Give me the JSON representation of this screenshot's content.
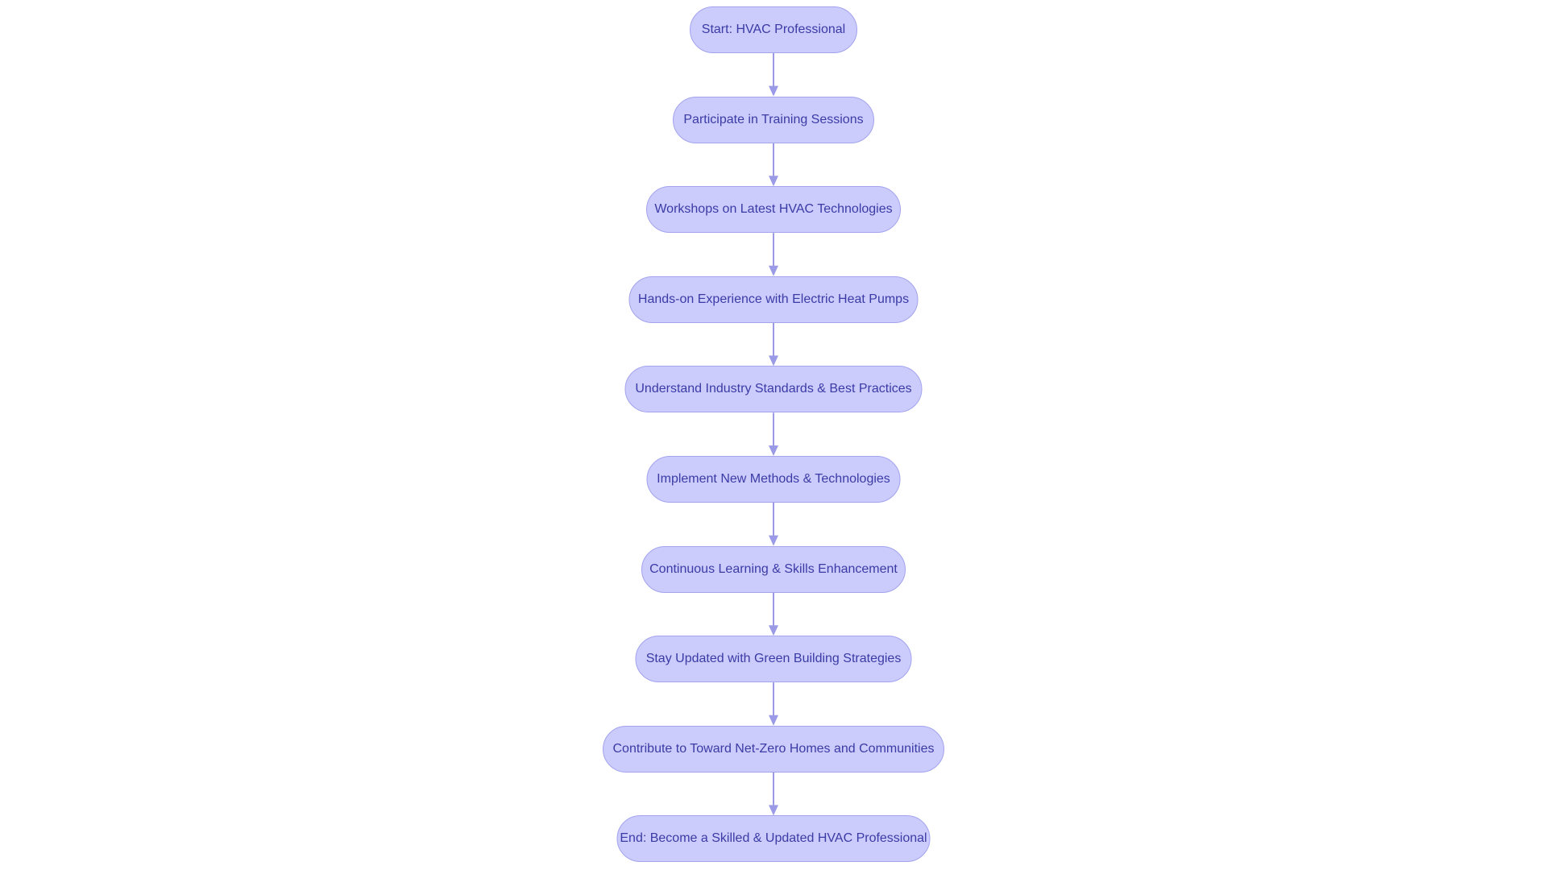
{
  "colors": {
    "node_fill": "#cbcbfc",
    "node_stroke": "#a3a3ee",
    "edge": "#9a9ae6",
    "text": "#3b3ba6"
  },
  "nodes": [
    {
      "label": "Start: HVAC Professional"
    },
    {
      "label": "Participate in Training Sessions"
    },
    {
      "label": "Workshops on Latest HVAC Technologies"
    },
    {
      "label": "Hands-on Experience with Electric Heat Pumps"
    },
    {
      "label": "Understand Industry Standards & Best Practices"
    },
    {
      "label": "Implement New Methods & Technologies"
    },
    {
      "label": "Continuous Learning & Skills Enhancement"
    },
    {
      "label": "Stay Updated with Green Building Strategies"
    },
    {
      "label": "Contribute to Toward Net-Zero Homes and Communities"
    },
    {
      "label": "End: Become a Skilled & Updated HVAC Professional"
    }
  ],
  "edges": [
    [
      0,
      1
    ],
    [
      1,
      2
    ],
    [
      2,
      3
    ],
    [
      3,
      4
    ],
    [
      4,
      5
    ],
    [
      5,
      6
    ],
    [
      6,
      7
    ],
    [
      7,
      8
    ],
    [
      8,
      9
    ]
  ]
}
